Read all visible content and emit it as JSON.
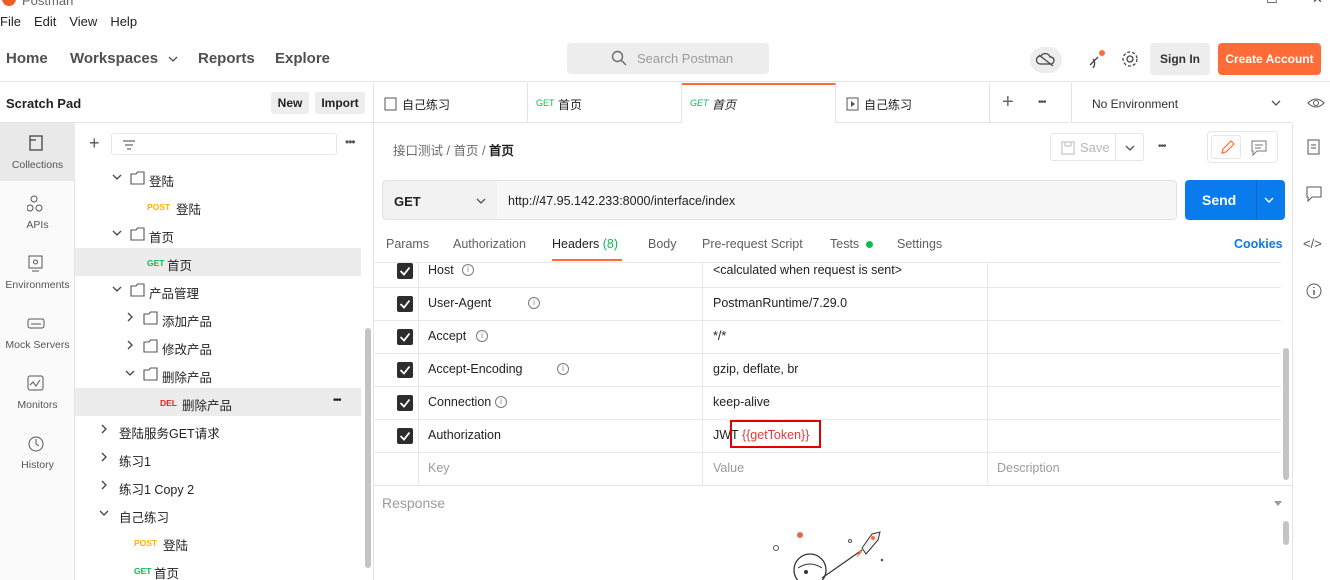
{
  "app": {
    "title": "Postman"
  },
  "menu": [
    "File",
    "Edit",
    "View",
    "Help"
  ],
  "nav": {
    "home": "Home",
    "workspaces": "Workspaces",
    "reports": "Reports",
    "explore": "Explore"
  },
  "search": {
    "placeholder": "Search Postman"
  },
  "account": {
    "sign_in": "Sign In",
    "create": "Create Account"
  },
  "scratchpad": {
    "title": "Scratch Pad",
    "new": "New",
    "import": "Import"
  },
  "rail": [
    "Collections",
    "APIs",
    "Environments",
    "Mock Servers",
    "Monitors",
    "History"
  ],
  "tree": [
    {
      "label": "登陆",
      "type": "folder",
      "depth": 1,
      "expanded": true
    },
    {
      "label": "登陆",
      "type": "request",
      "method": "POST",
      "depth": 2
    },
    {
      "label": "首页",
      "type": "folder",
      "depth": 1,
      "expanded": true
    },
    {
      "label": "首页",
      "type": "request",
      "method": "GET",
      "depth": 2,
      "selected": true
    },
    {
      "label": "产品管理",
      "type": "folder",
      "depth": 1,
      "expanded": true
    },
    {
      "label": "添加产品",
      "type": "folder",
      "depth": 2,
      "expanded": false
    },
    {
      "label": "修改产品",
      "type": "folder",
      "depth": 2,
      "expanded": false
    },
    {
      "label": "删除产品",
      "type": "folder",
      "depth": 2,
      "expanded": true
    },
    {
      "label": "删除产品",
      "type": "request",
      "method": "DEL",
      "depth": 3,
      "selected": true
    },
    {
      "label": "登陆服务GET请求",
      "type": "collection",
      "depth": 0,
      "expanded": false
    },
    {
      "label": "练习1",
      "type": "collection",
      "depth": 0,
      "expanded": false
    },
    {
      "label": "练习1 Copy 2",
      "type": "collection",
      "depth": 0,
      "expanded": false
    },
    {
      "label": "自己练习",
      "type": "collection",
      "depth": 0,
      "expanded": true
    },
    {
      "label": "登陆",
      "type": "request",
      "method": "POST",
      "depth": 1
    },
    {
      "label": "首页",
      "type": "request",
      "method": "GET",
      "depth": 1
    }
  ],
  "tabs": [
    {
      "label": "自己练习",
      "kind": "collection"
    },
    {
      "label": "首页",
      "method": "GET"
    },
    {
      "label": "首页",
      "method": "GET",
      "active": true
    },
    {
      "label": "自己练习",
      "kind": "runner"
    }
  ],
  "environment": "No Environment",
  "breadcrumb": {
    "part1": "接口测试",
    "part2": "首页",
    "current": "首页"
  },
  "save": "Save",
  "request": {
    "method": "GET",
    "url": "http://47.95.142.233:8000/interface/index",
    "send": "Send"
  },
  "req_tabs": [
    "Params",
    "Authorization",
    "Headers",
    "Body",
    "Pre-request Script",
    "Tests",
    "Settings"
  ],
  "headers_count": "(8)",
  "cookies": "Cookies",
  "headers": [
    {
      "key": "Host",
      "value": "<calculated when request is sent>"
    },
    {
      "key": "User-Agent",
      "value": "PostmanRuntime/7.29.0"
    },
    {
      "key": "Accept",
      "value": "*/*"
    },
    {
      "key": "Accept-Encoding",
      "value": "gzip, deflate, br"
    },
    {
      "key": "Connection",
      "value": "keep-alive"
    },
    {
      "key": "Authorization",
      "value_prefix": "JWT ",
      "value_var": "{{getToken}}"
    }
  ],
  "header_placeholders": {
    "key": "Key",
    "value": "Value",
    "description": "Description"
  },
  "response": {
    "title": "Response"
  },
  "colors": {
    "accent": "#ff6c37",
    "send": "#097bed",
    "get": "#0cbb52",
    "post": "#ffb400",
    "del": "#eb2013",
    "variable": "#e03a3a"
  }
}
